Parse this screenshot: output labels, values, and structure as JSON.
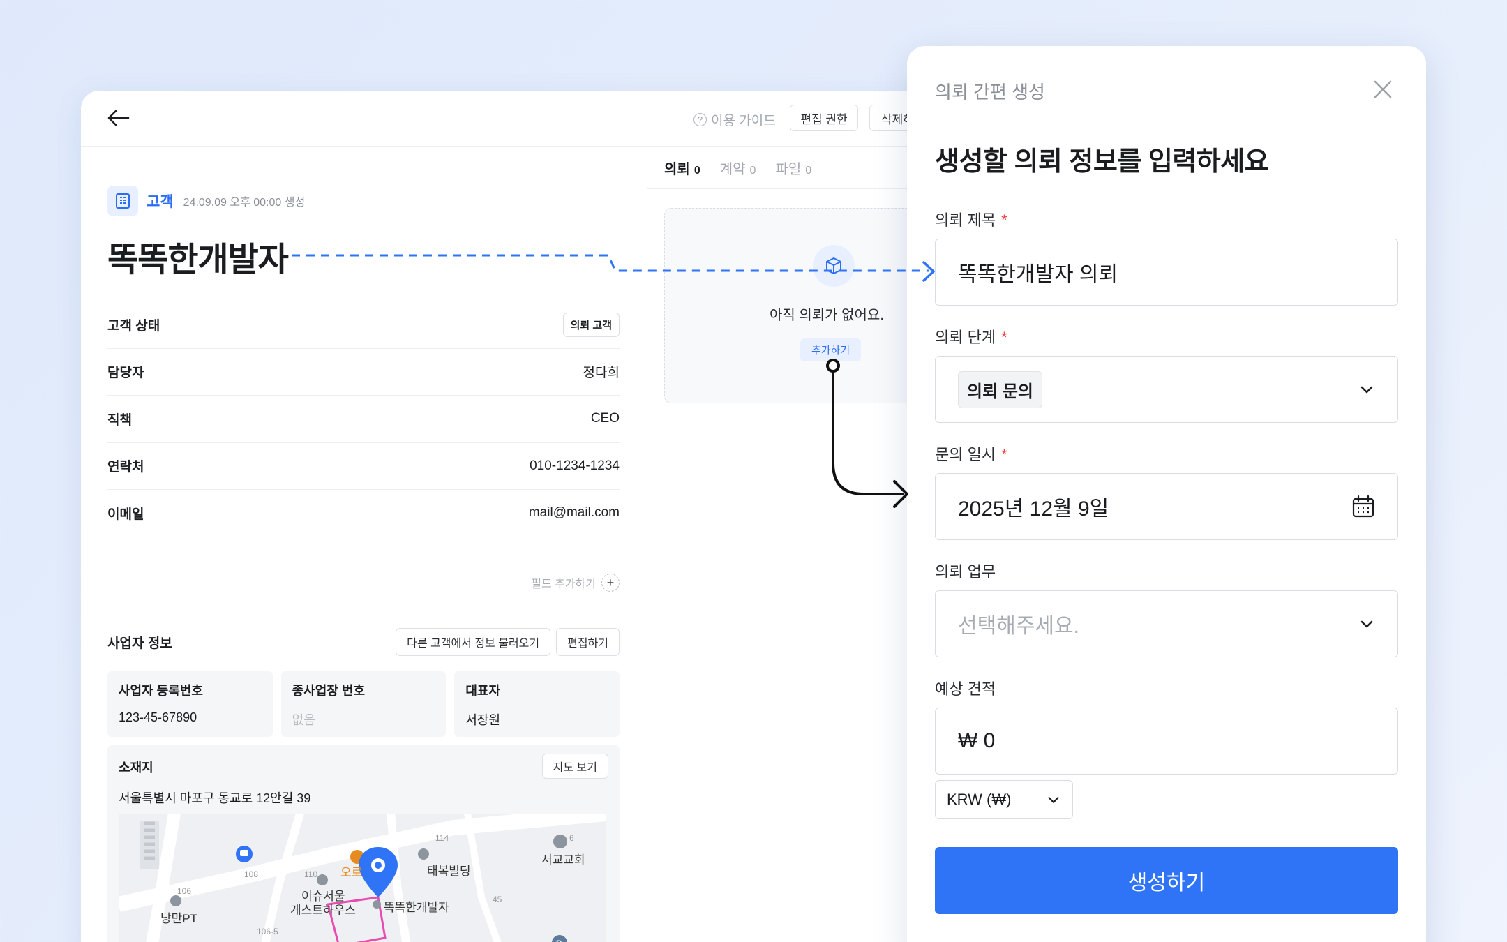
{
  "topbar": {
    "guide_label": "이용 가이드",
    "edit_permission_label": "편집 권한",
    "delete_label": "삭제하"
  },
  "customer": {
    "badge_label": "고객",
    "created": "24.09.09 오후 00:00 생성",
    "name": "똑똑한개발자",
    "fields": [
      {
        "label": "고객 상태",
        "value": "의뢰 고객",
        "chip": true
      },
      {
        "label": "담당자",
        "value": "정다희"
      },
      {
        "label": "직책",
        "value": "CEO"
      },
      {
        "label": "연락처",
        "value": "010-1234-1234"
      },
      {
        "label": "이메일",
        "value": "mail@mail.com"
      }
    ],
    "add_field_label": "필드 추가하기"
  },
  "business": {
    "title": "사업자 정보",
    "import_label": "다른 고객에서 정보 불러오기",
    "edit_label": "편집하기",
    "cells": [
      {
        "label": "사업자 등록번호",
        "value": "123-45-67890"
      },
      {
        "label": "종사업장 번호",
        "value": "없음"
      },
      {
        "label": "대표자",
        "value": "서장원"
      }
    ],
    "location": {
      "title": "소재지",
      "map_button": "지도 보기",
      "address": "서울특별시 마포구 동교로 12안길 39",
      "map_labels": {
        "taebok": "태복빌딩",
        "seogyo": "서교교회",
        "target": "똑똑한개발자",
        "guesthouse_1": "이슈서울",
        "guesthouse_2": "게스트하우스",
        "nangman": "낭만PT",
        "ore": "오로",
        "n108": "108",
        "n106": "106",
        "n110": "110",
        "n114": "114",
        "n45": "45",
        "n1065": "106-5",
        "n6": "6"
      }
    }
  },
  "tabs": [
    {
      "label": "의뢰",
      "count": "0",
      "active": true
    },
    {
      "label": "계약",
      "count": "0"
    },
    {
      "label": "파일",
      "count": "0"
    }
  ],
  "empty_state": {
    "text": "아직 의뢰가 없어요.",
    "add_label": "추가하기"
  },
  "modal": {
    "subtitle": "의뢰 간편 생성",
    "title": "생성할 의뢰 정보를 입력하세요",
    "title_field": {
      "label": "의뢰 제목",
      "required_mark": "*",
      "value": "똑똑한개발자 의뢰"
    },
    "stage_field": {
      "label": "의뢰 단계",
      "required_mark": "*",
      "value": "의뢰 문의"
    },
    "date_field": {
      "label": "문의 일시",
      "required_mark": "*",
      "value": "2025년 12월 9일"
    },
    "task_field": {
      "label": "의뢰 업무",
      "placeholder": "선택해주세요."
    },
    "estimate_field": {
      "label": "예상 견적",
      "value": "₩ 0"
    },
    "currency": "KRW (₩)",
    "submit_label": "생성하기"
  },
  "colors": {
    "accent": "#2f74f6",
    "required": "#ef4444",
    "connector_dashed": "#2f74f6",
    "connector_solid": "#111111"
  }
}
